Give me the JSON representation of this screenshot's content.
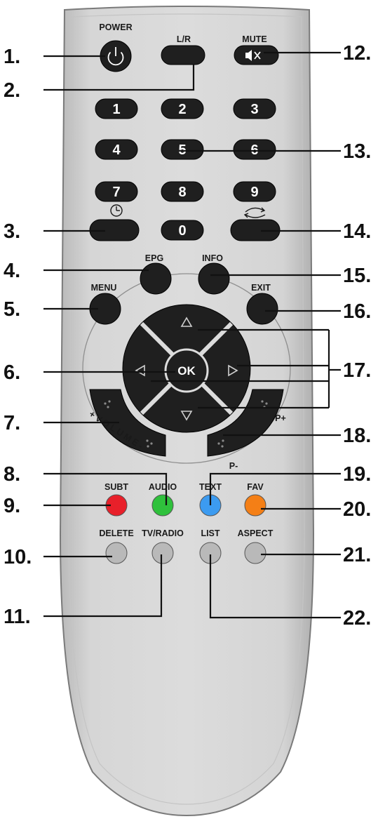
{
  "remote": {
    "top_labels": {
      "power": "POWER",
      "lr": "L/R",
      "mute": "MUTE"
    },
    "number_keys": [
      "1",
      "2",
      "3",
      "4",
      "5",
      "6",
      "7",
      "8",
      "9",
      "0"
    ],
    "nav_labels": {
      "epg": "EPG",
      "info": "INFO",
      "menu": "MENU",
      "exit": "EXIT",
      "ok": "OK"
    },
    "arc_labels": {
      "volume": "+VOLUME-",
      "p_plus": "P+",
      "p_minus": "P-"
    },
    "color_labels": [
      "SUBT",
      "AUDIO",
      "TEXT",
      "FAV"
    ],
    "color_keys": [
      "#e8202a",
      "#2fc13c",
      "#3c9bf0",
      "#f47f16"
    ],
    "grey_labels": [
      "DELETE",
      "TV/RADIO",
      "LIST",
      "ASPECT"
    ],
    "callouts": [
      "1.",
      "2.",
      "3.",
      "4.",
      "5.",
      "6.",
      "7.",
      "8.",
      "9.",
      "10.",
      "11.",
      "12.",
      "13.",
      "14.",
      "15.",
      "16.",
      "17.",
      "18.",
      "19.",
      "20.",
      "21.",
      "22."
    ]
  }
}
